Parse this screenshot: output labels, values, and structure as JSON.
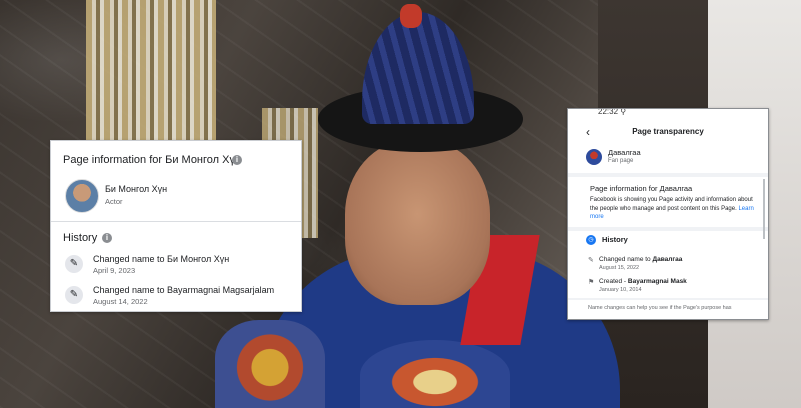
{
  "left_card": {
    "title": "Page information for Би Монгол Хүн",
    "page_name": "Би Монгол Хүн",
    "page_role": "Actor",
    "history_label": "History",
    "events": [
      {
        "text": "Changed name to Би Монгол Хүн",
        "date": "April 9, 2023"
      },
      {
        "text": "Changed name to Bayarmagnai Magsarjalam",
        "date": "August 14, 2022"
      }
    ]
  },
  "right_card": {
    "status_time": "22:32 ⚲",
    "header_title": "Page transparency",
    "page_name": "Давалгаа",
    "page_type": "Fan page",
    "info_title": "Page information for Давалгаа",
    "info_body": "Facebook is showing you Page activity and information about the people who manage and post content on this Page.",
    "learn_more": "Learn more",
    "history_label": "History",
    "events": [
      {
        "prefix": "Changed name to ",
        "name": "Давалгаа",
        "date": "August 15, 2022"
      },
      {
        "prefix": "Created - ",
        "name": "Bayarmagnai Mask",
        "date": "January 10, 2014"
      }
    ],
    "footer_text": "Name changes can help you see if the Page's purpose has"
  },
  "colors": {
    "facebook_blue": "#1877f2",
    "robe_blue": "#1f3a86",
    "sash_red": "#c8242a"
  },
  "icons": {
    "info": "info-icon",
    "history_event": "edit-circle-icon",
    "back": "chevron-left-icon",
    "history": "clock-icon",
    "created": "flag-icon"
  }
}
